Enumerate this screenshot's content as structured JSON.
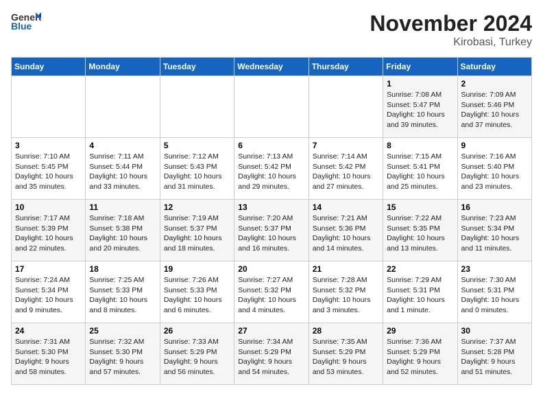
{
  "header": {
    "logo_general": "General",
    "logo_blue": "Blue",
    "month_title": "November 2024",
    "location": "Kirobasi, Turkey"
  },
  "weekdays": [
    "Sunday",
    "Monday",
    "Tuesday",
    "Wednesday",
    "Thursday",
    "Friday",
    "Saturday"
  ],
  "weeks": [
    [
      {
        "day": "",
        "info": ""
      },
      {
        "day": "",
        "info": ""
      },
      {
        "day": "",
        "info": ""
      },
      {
        "day": "",
        "info": ""
      },
      {
        "day": "",
        "info": ""
      },
      {
        "day": "1",
        "info": "Sunrise: 7:08 AM\nSunset: 5:47 PM\nDaylight: 10 hours\nand 39 minutes."
      },
      {
        "day": "2",
        "info": "Sunrise: 7:09 AM\nSunset: 5:46 PM\nDaylight: 10 hours\nand 37 minutes."
      }
    ],
    [
      {
        "day": "3",
        "info": "Sunrise: 7:10 AM\nSunset: 5:45 PM\nDaylight: 10 hours\nand 35 minutes."
      },
      {
        "day": "4",
        "info": "Sunrise: 7:11 AM\nSunset: 5:44 PM\nDaylight: 10 hours\nand 33 minutes."
      },
      {
        "day": "5",
        "info": "Sunrise: 7:12 AM\nSunset: 5:43 PM\nDaylight: 10 hours\nand 31 minutes."
      },
      {
        "day": "6",
        "info": "Sunrise: 7:13 AM\nSunset: 5:42 PM\nDaylight: 10 hours\nand 29 minutes."
      },
      {
        "day": "7",
        "info": "Sunrise: 7:14 AM\nSunset: 5:42 PM\nDaylight: 10 hours\nand 27 minutes."
      },
      {
        "day": "8",
        "info": "Sunrise: 7:15 AM\nSunset: 5:41 PM\nDaylight: 10 hours\nand 25 minutes."
      },
      {
        "day": "9",
        "info": "Sunrise: 7:16 AM\nSunset: 5:40 PM\nDaylight: 10 hours\nand 23 minutes."
      }
    ],
    [
      {
        "day": "10",
        "info": "Sunrise: 7:17 AM\nSunset: 5:39 PM\nDaylight: 10 hours\nand 22 minutes."
      },
      {
        "day": "11",
        "info": "Sunrise: 7:18 AM\nSunset: 5:38 PM\nDaylight: 10 hours\nand 20 minutes."
      },
      {
        "day": "12",
        "info": "Sunrise: 7:19 AM\nSunset: 5:37 PM\nDaylight: 10 hours\nand 18 minutes."
      },
      {
        "day": "13",
        "info": "Sunrise: 7:20 AM\nSunset: 5:37 PM\nDaylight: 10 hours\nand 16 minutes."
      },
      {
        "day": "14",
        "info": "Sunrise: 7:21 AM\nSunset: 5:36 PM\nDaylight: 10 hours\nand 14 minutes."
      },
      {
        "day": "15",
        "info": "Sunrise: 7:22 AM\nSunset: 5:35 PM\nDaylight: 10 hours\nand 13 minutes."
      },
      {
        "day": "16",
        "info": "Sunrise: 7:23 AM\nSunset: 5:34 PM\nDaylight: 10 hours\nand 11 minutes."
      }
    ],
    [
      {
        "day": "17",
        "info": "Sunrise: 7:24 AM\nSunset: 5:34 PM\nDaylight: 10 hours\nand 9 minutes."
      },
      {
        "day": "18",
        "info": "Sunrise: 7:25 AM\nSunset: 5:33 PM\nDaylight: 10 hours\nand 8 minutes."
      },
      {
        "day": "19",
        "info": "Sunrise: 7:26 AM\nSunset: 5:33 PM\nDaylight: 10 hours\nand 6 minutes."
      },
      {
        "day": "20",
        "info": "Sunrise: 7:27 AM\nSunset: 5:32 PM\nDaylight: 10 hours\nand 4 minutes."
      },
      {
        "day": "21",
        "info": "Sunrise: 7:28 AM\nSunset: 5:32 PM\nDaylight: 10 hours\nand 3 minutes."
      },
      {
        "day": "22",
        "info": "Sunrise: 7:29 AM\nSunset: 5:31 PM\nDaylight: 10 hours\nand 1 minute."
      },
      {
        "day": "23",
        "info": "Sunrise: 7:30 AM\nSunset: 5:31 PM\nDaylight: 10 hours\nand 0 minutes."
      }
    ],
    [
      {
        "day": "24",
        "info": "Sunrise: 7:31 AM\nSunset: 5:30 PM\nDaylight: 9 hours\nand 58 minutes."
      },
      {
        "day": "25",
        "info": "Sunrise: 7:32 AM\nSunset: 5:30 PM\nDaylight: 9 hours\nand 57 minutes."
      },
      {
        "day": "26",
        "info": "Sunrise: 7:33 AM\nSunset: 5:29 PM\nDaylight: 9 hours\nand 56 minutes."
      },
      {
        "day": "27",
        "info": "Sunrise: 7:34 AM\nSunset: 5:29 PM\nDaylight: 9 hours\nand 54 minutes."
      },
      {
        "day": "28",
        "info": "Sunrise: 7:35 AM\nSunset: 5:29 PM\nDaylight: 9 hours\nand 53 minutes."
      },
      {
        "day": "29",
        "info": "Sunrise: 7:36 AM\nSunset: 5:29 PM\nDaylight: 9 hours\nand 52 minutes."
      },
      {
        "day": "30",
        "info": "Sunrise: 7:37 AM\nSunset: 5:28 PM\nDaylight: 9 hours\nand 51 minutes."
      }
    ]
  ]
}
